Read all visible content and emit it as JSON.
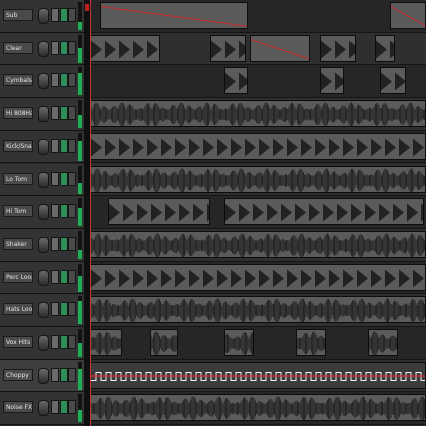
{
  "tracks": [
    {
      "name": "Sub",
      "active": false
    },
    {
      "name": "Clear",
      "active": false
    },
    {
      "name": "Cymbals",
      "active": false
    },
    {
      "name": "Hi 808Hat",
      "active": false
    },
    {
      "name": "Kick/Snare",
      "active": false
    },
    {
      "name": "Lo Tom",
      "active": false
    },
    {
      "name": "Hi Tom",
      "active": false
    },
    {
      "name": "Shaker",
      "active": false
    },
    {
      "name": "Perc Loop",
      "active": false
    },
    {
      "name": "Hats Loop",
      "active": false
    },
    {
      "name": "Vox Hits",
      "active": false
    },
    {
      "name": "Choppy",
      "active": true
    },
    {
      "name": "Noise FX",
      "active": false
    }
  ],
  "colors": {
    "selection_accent": "#bb2222",
    "mute_active": "#2f8f5a",
    "meter": "#1fae54",
    "automation": "#dd2a2a"
  }
}
